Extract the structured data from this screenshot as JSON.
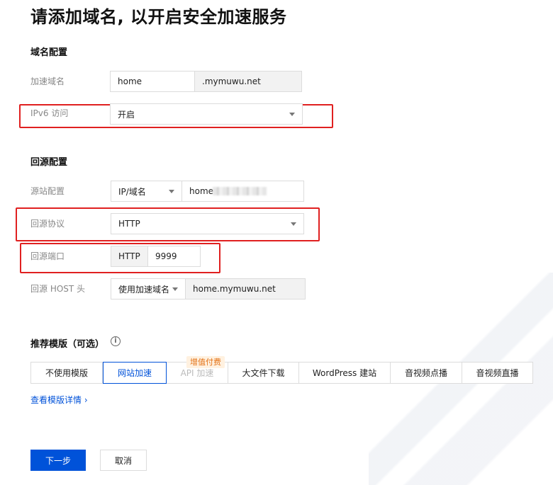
{
  "title": "请添加域名, 以开启安全加速服务",
  "domain_section": {
    "heading": "域名配置",
    "domain_label": "加速域名",
    "domain_prefix_value": "home",
    "domain_suffix": ".mymuwu.net",
    "ipv6_label": "IPv6 访问",
    "ipv6_value": "开启"
  },
  "origin_section": {
    "heading": "回源配置",
    "source_label": "源站配置",
    "source_type": "IP/域名",
    "source_value": "home",
    "protocol_label": "回源协议",
    "protocol_value": "HTTP",
    "port_label": "回源端口",
    "port_prefix": "HTTP",
    "port_value": "9999",
    "host_label": "回源 HOST 头",
    "host_type": "使用加速域名",
    "host_value": "home.mymuwu.net"
  },
  "template_section": {
    "heading": "推荐模版（可选）",
    "info_icon": "info-icon",
    "paid_badge": "增值付费",
    "tabs": [
      {
        "label": "不使用模版"
      },
      {
        "label": "网站加速"
      },
      {
        "label": "API 加速"
      },
      {
        "label": "大文件下载"
      },
      {
        "label": "WordPress 建站"
      },
      {
        "label": "音视频点播"
      },
      {
        "label": "音视频直播"
      }
    ],
    "details_link": "查看模版详情 ›"
  },
  "actions": {
    "next_label": "下一步",
    "cancel_label": "取消"
  },
  "colors": {
    "primary": "#0052d9",
    "highlight_border": "#e02020",
    "badge_text": "#e37318"
  }
}
